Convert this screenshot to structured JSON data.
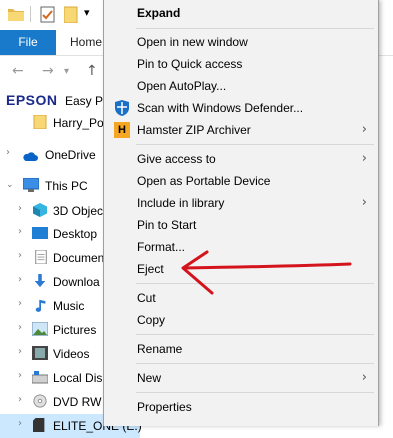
{
  "ribbon": {
    "file_tab": "File",
    "home_tab": "Home"
  },
  "nav": {
    "back": "←",
    "forward": "→",
    "up": "↑"
  },
  "tree": [
    {
      "id": "epson",
      "label": "Easy Ph"
    },
    {
      "id": "harry",
      "label": "Harry_Pot"
    },
    {
      "id": "onedrive",
      "label": "OneDrive"
    },
    {
      "id": "thispc",
      "label": "This PC"
    },
    {
      "id": "3d",
      "label": "3D Objec"
    },
    {
      "id": "desktop",
      "label": "Desktop"
    },
    {
      "id": "documents",
      "label": "Documen"
    },
    {
      "id": "downloads",
      "label": "Downloa"
    },
    {
      "id": "music",
      "label": "Music"
    },
    {
      "id": "pictures",
      "label": "Pictures"
    },
    {
      "id": "videos",
      "label": "Videos"
    },
    {
      "id": "localdisk",
      "label": "Local Disk"
    },
    {
      "id": "dvd",
      "label": "DVD RW"
    },
    {
      "id": "elite",
      "label": "ELITE_ONE (E:)"
    }
  ],
  "epson_logo": "EPSON",
  "menu": {
    "expand": "Expand",
    "open_new_window": "Open in new window",
    "pin_quick_access": "Pin to Quick access",
    "open_autoplay": "Open AutoPlay...",
    "scan_defender": "Scan with Windows Defender...",
    "hamster_zip": "Hamster ZIP Archiver",
    "give_access": "Give access to",
    "open_portable": "Open as Portable Device",
    "include_library": "Include in library",
    "pin_start": "Pin to Start",
    "format": "Format...",
    "eject": "Eject",
    "cut": "Cut",
    "copy": "Copy",
    "rename": "Rename",
    "new": "New",
    "properties": "Properties",
    "hamster_icon_letter": "H"
  },
  "colors": {
    "file_tab": "#1979ca",
    "annotation_arrow": "#d4141c",
    "selection": "#cce8ff"
  }
}
